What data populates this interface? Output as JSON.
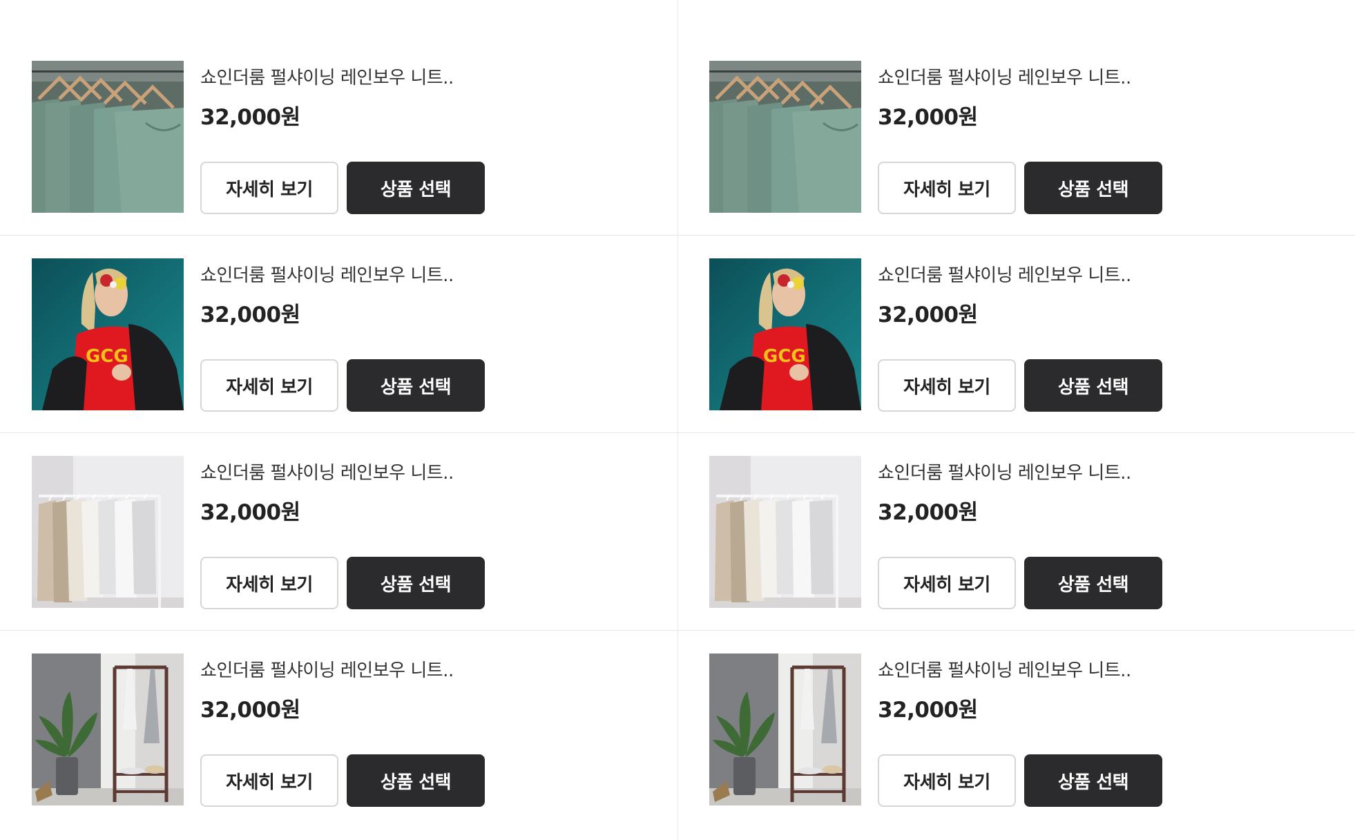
{
  "products": [
    {
      "title": "쇼인더룸 펄샤이닝 레인보우 니트..",
      "price": "32,000원",
      "detail_label": "자세히 보기",
      "select_label": "상품 선택",
      "image": "green-tshirts-on-hangers"
    },
    {
      "title": "쇼인더룸 펄샤이닝 레인보우 니트..",
      "price": "32,000원",
      "detail_label": "자세히 보기",
      "select_label": "상품 선택",
      "image": "green-tshirts-on-hangers"
    },
    {
      "title": "쇼인더룸 펄샤이닝 레인보우 니트..",
      "price": "32,000원",
      "detail_label": "자세히 보기",
      "select_label": "상품 선택",
      "image": "woman-red-shirt-sunglasses"
    },
    {
      "title": "쇼인더룸 펄샤이닝 레인보우 니트..",
      "price": "32,000원",
      "detail_label": "자세히 보기",
      "select_label": "상품 선택",
      "image": "woman-red-shirt-sunglasses"
    },
    {
      "title": "쇼인더룸 펄샤이닝 레인보우 니트..",
      "price": "32,000원",
      "detail_label": "자세히 보기",
      "select_label": "상품 선택",
      "image": "neutral-clothes-rack"
    },
    {
      "title": "쇼인더룸 펄샤이닝 레인보우 니트..",
      "price": "32,000원",
      "detail_label": "자세히 보기",
      "select_label": "상품 선택",
      "image": "neutral-clothes-rack"
    },
    {
      "title": "쇼인더룸 펄샤이닝 레인보우 니트..",
      "price": "32,000원",
      "detail_label": "자세히 보기",
      "select_label": "상품 선택",
      "image": "room-rack-with-plant"
    },
    {
      "title": "쇼인더룸 펄샤이닝 레인보우 니트..",
      "price": "32,000원",
      "detail_label": "자세히 보기",
      "select_label": "상품 선택",
      "image": "room-rack-with-plant"
    }
  ],
  "colors": {
    "select_button_bg": "#2b2b2d",
    "detail_button_border": "#d6d6d6",
    "divider": "#e6e6e6"
  }
}
